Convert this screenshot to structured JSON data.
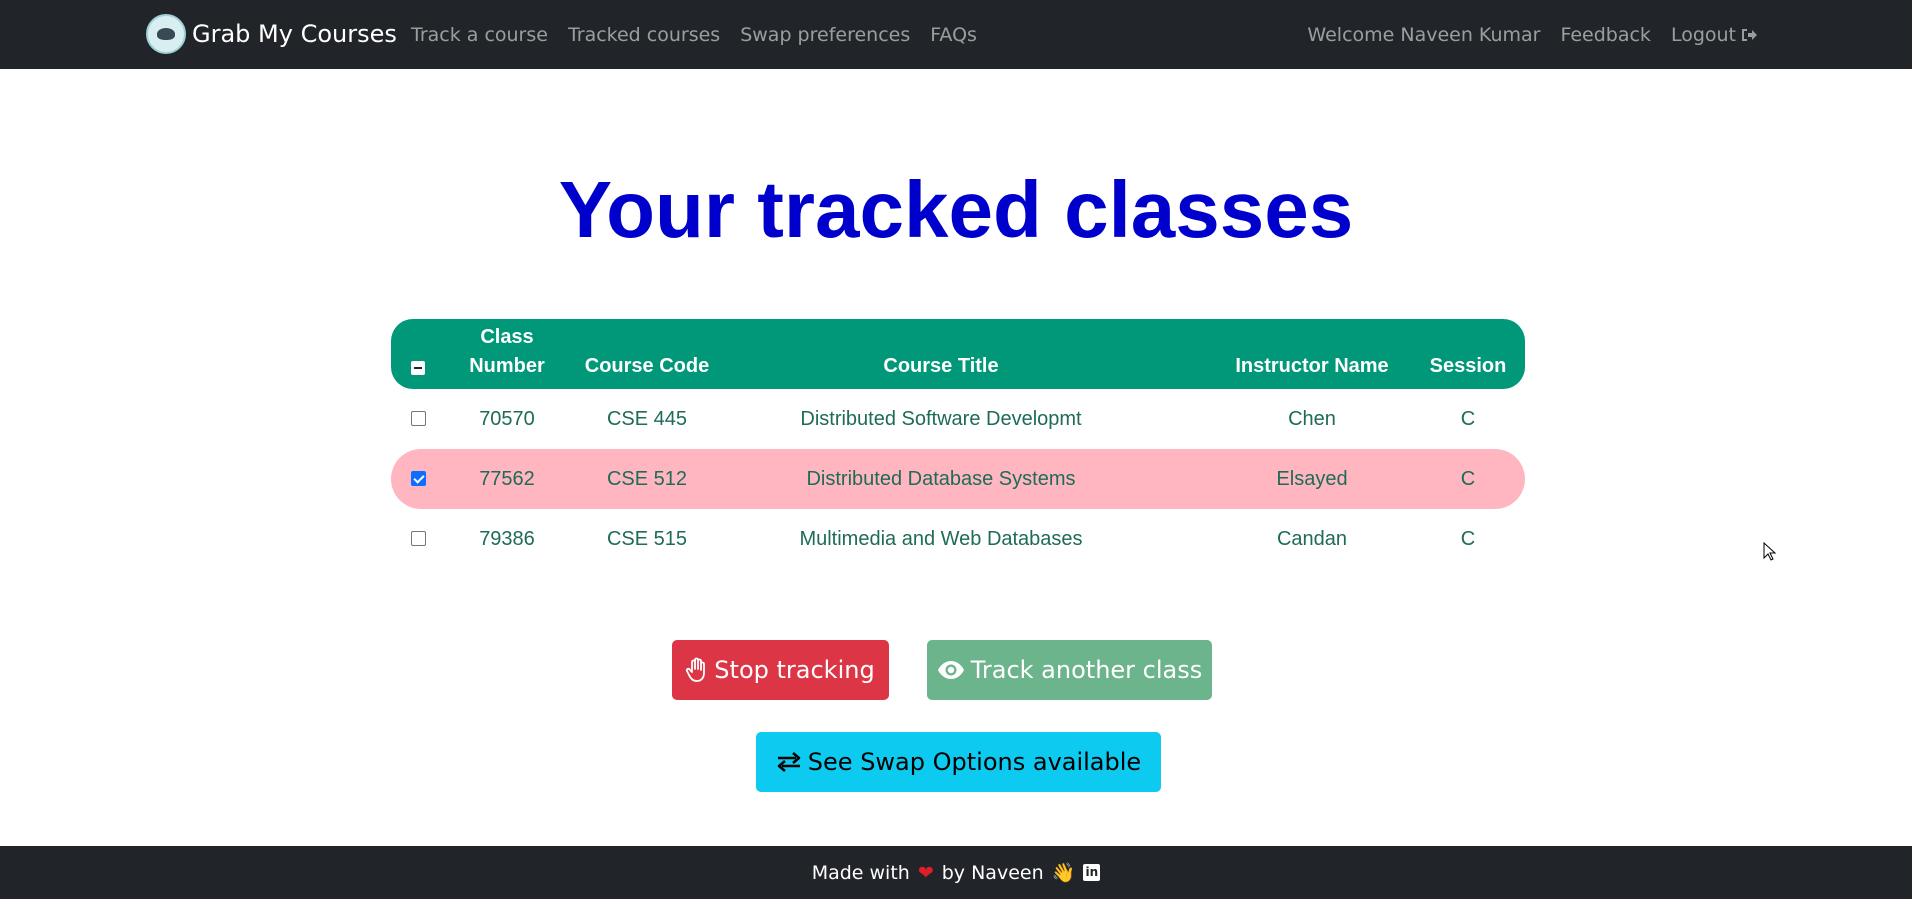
{
  "navbar": {
    "brand": "Grab My Courses",
    "links": [
      "Track a course",
      "Tracked courses",
      "Swap preferences",
      "FAQs"
    ],
    "welcome": "Welcome Naveen Kumar",
    "feedback": "Feedback",
    "logout": "Logout",
    "logout_icon": "sign-out-icon"
  },
  "main": {
    "title": "Your tracked classes",
    "table": {
      "headers": {
        "class_number_line1": "Class",
        "class_number_line2": "Number",
        "course_code": "Course Code",
        "course_title": "Course Title",
        "instructor": "Instructor Name",
        "session": "Session"
      },
      "rows": [
        {
          "class_number": "70570",
          "course_code": "CSE 445",
          "course_title": "Distributed Software Developmt",
          "instructor": "Chen",
          "session": "C",
          "checked": false
        },
        {
          "class_number": "77562",
          "course_code": "CSE 512",
          "course_title": "Distributed Database Systems",
          "instructor": "Elsayed",
          "session": "C",
          "checked": true
        },
        {
          "class_number": "79386",
          "course_code": "CSE 515",
          "course_title": "Multimedia and Web Databases",
          "instructor": "Candan",
          "session": "C",
          "checked": false
        }
      ]
    },
    "buttons": {
      "stop_tracking": "Stop tracking",
      "track_another": "Track another class",
      "swap_options": "See Swap Options available"
    }
  },
  "footer": {
    "made_with": "Made with",
    "by": "by Naveen",
    "heart_icon": "heart-icon",
    "wave_icon": "waving-hand-icon",
    "linkedin_icon": "linkedin-icon"
  },
  "colors": {
    "navbar": "#212529",
    "title": "#0000cd",
    "table_header": "#009879",
    "selected_row": "#ffb6c1",
    "stop_button": "#dc3545",
    "track_button": "#6cb48c",
    "swap_button": "#0dcaf0"
  }
}
